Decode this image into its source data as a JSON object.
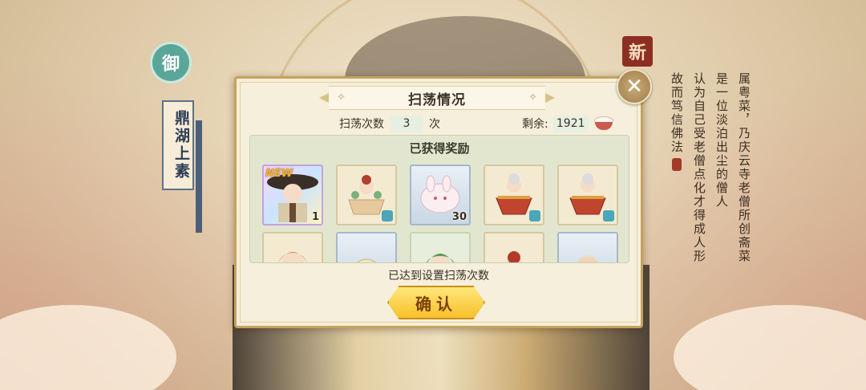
{
  "background": {
    "left_badge": "御",
    "dish_name": "鼎湖上素",
    "new_seal": "新",
    "description_columns": [
      "属粤菜，乃庆云寺老僧所创斋菜",
      "是一位淡泊出尘的僧人",
      "认为自己受老僧点化才得成人形",
      "故而笃信佛法"
    ]
  },
  "dialog": {
    "title": "扫荡情况",
    "sweep_count_label": "扫荡次数",
    "sweep_count_value": "3",
    "sweep_count_unit": "次",
    "remaining_label": "剩余:",
    "remaining_value": "1921",
    "remaining_icon": "rice-bowl-icon",
    "rewards_title": "已获得奖励",
    "rewards": [
      {
        "kind": "hero",
        "new": "NEW",
        "qty": "1",
        "icon": "monk-character-icon"
      },
      {
        "kind": "food",
        "qty": "",
        "icon": "tea-cup-character-icon",
        "badge": true
      },
      {
        "kind": "blue",
        "qty": "30",
        "icon": "bun-item-icon"
      },
      {
        "kind": "food",
        "qty": "",
        "icon": "soup-bowl-character-icon",
        "badge": true
      },
      {
        "kind": "food",
        "qty": "",
        "icon": "soup-bowl-character-icon",
        "badge": true
      },
      {
        "kind": "food",
        "qty": "",
        "icon": "blonde-character-icon"
      },
      {
        "kind": "blue",
        "qty": "",
        "icon": "dumpling-item-icon"
      },
      {
        "kind": "green",
        "qty": "",
        "icon": "green-hair-character-icon"
      },
      {
        "kind": "food",
        "qty": "",
        "icon": "red-hair-character-icon"
      },
      {
        "kind": "blue",
        "qty": "",
        "icon": "silver-hair-character-icon"
      }
    ],
    "status_text": "已达到设置扫荡次数",
    "confirm_label": "确认",
    "close_icon": "close-icon",
    "colors": {
      "accent": "#f7c12b",
      "frame": "#c7a15c"
    }
  }
}
